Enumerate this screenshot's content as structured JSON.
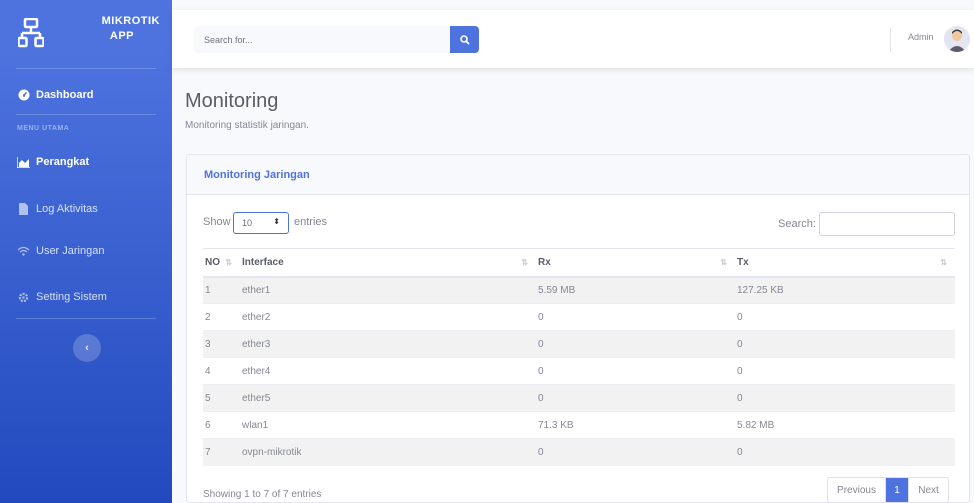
{
  "brand": {
    "line1": "MIKROTIK",
    "line2": "APP",
    "icon": "sitemap-icon"
  },
  "sidebar": {
    "dashboard": "Dashboard",
    "heading": "MENU UTAMA",
    "items": [
      {
        "label": "Perangkat",
        "icon": "chart-area-icon",
        "active": true
      },
      {
        "label": "Log Aktivitas",
        "icon": "file-icon",
        "active": false
      },
      {
        "label": "User Jaringan",
        "icon": "wifi-icon",
        "active": false
      },
      {
        "label": "Setting Sistem",
        "icon": "gear-icon",
        "active": false
      }
    ],
    "toggle": "‹"
  },
  "topbar": {
    "search_placeholder": "Search for...",
    "user": "Admin"
  },
  "page": {
    "title": "Monitoring",
    "subtitle": "Monitoring statistik jaringan."
  },
  "card": {
    "title": "Monitoring Jaringan",
    "show_label": "Show",
    "entries_value": "10",
    "entries_label": "entries",
    "search_label": "Search:",
    "columns": [
      "NO",
      "Interface",
      "Rx",
      "Tx"
    ],
    "rows": [
      [
        "1",
        "ether1",
        "5.59 MB",
        "127.25 KB"
      ],
      [
        "2",
        "ether2",
        "0",
        "0"
      ],
      [
        "3",
        "ether3",
        "0",
        "0"
      ],
      [
        "4",
        "ether4",
        "0",
        "0"
      ],
      [
        "5",
        "ether5",
        "0",
        "0"
      ],
      [
        "6",
        "wlan1",
        "71.3 KB",
        "5.82 MB"
      ],
      [
        "7",
        "ovpn-mikrotik",
        "0",
        "0"
      ]
    ],
    "info": "Showing 1 to 7 of 7 entries",
    "pager": {
      "previous": "Previous",
      "current": "1",
      "next": "Next"
    }
  },
  "colors": {
    "primary": "#4e73df",
    "sidebar_end": "#224abe"
  }
}
